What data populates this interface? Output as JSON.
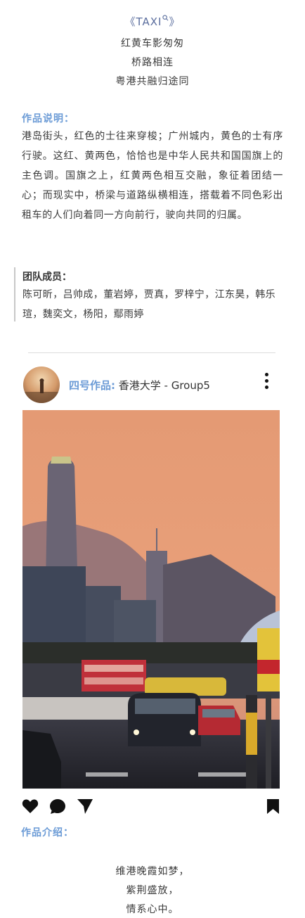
{
  "header": {
    "title": "《TAXI",
    "title_end": "》",
    "lines": [
      "红黄车影匆匆",
      "桥路相连",
      "粤港共融归途同"
    ]
  },
  "description": {
    "label": "作品说明：",
    "text": "港岛街头，红色的士往来穿梭；广州城内，黄色的士有序行驶。这红、黄两色，恰恰也是中华人民共和国国旗上的主色调。国旗之上，红黄两色相互交融，象征着团结一心；而现实中，桥梁与道路纵横相连，搭载着不同色彩出租车的人们向着同一方向前行，驶向共同的归属。"
  },
  "team": {
    "label": "团队成员：",
    "names": "陈可昕，吕帅成，董岩婷，贾真，罗梓宁，江东昊，韩乐瑄，魏奕文，杨阳，鄢雨婷"
  },
  "post": {
    "label": "四号作品:",
    "author": " 香港大学 - Group5",
    "intro_label": "作品介绍：",
    "poem": [
      "维港晚霞如梦，",
      "紫荆盛放，",
      "情系心中。"
    ]
  },
  "icons": [
    "heart-icon",
    "comment-icon",
    "share-icon",
    "bookmark-icon",
    "more-vertical-icon",
    "search-icon"
  ],
  "colors": {
    "accent": "#6b9bd6",
    "title": "#5b6e9e"
  }
}
